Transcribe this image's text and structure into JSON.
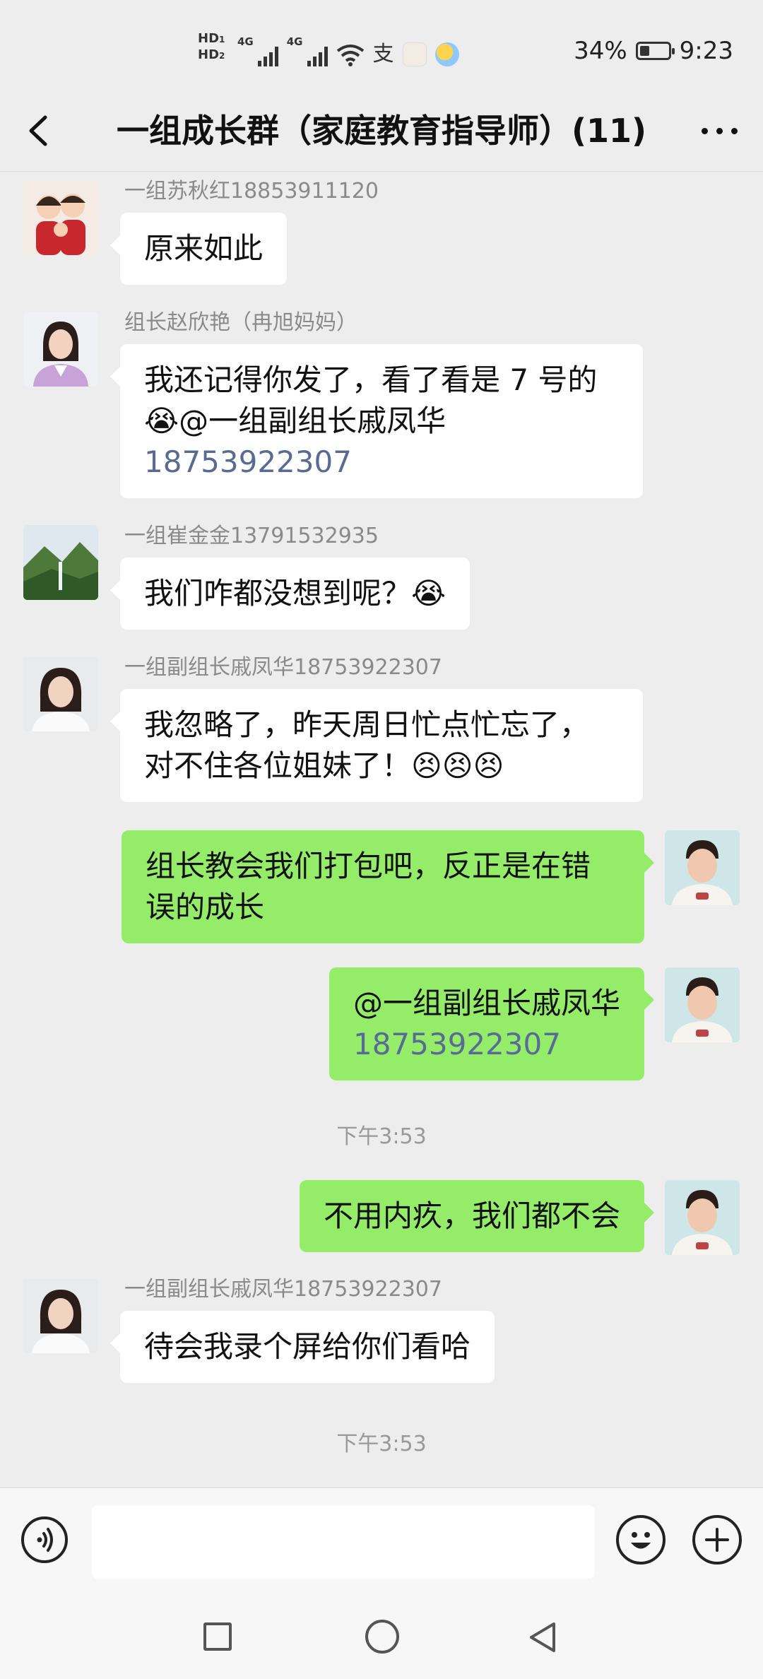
{
  "status_bar": {
    "hd1": "HD",
    "hd2": "HD",
    "network": "4G",
    "battery_text": "34%",
    "battery_level": 0.34,
    "time": "9:23"
  },
  "nav": {
    "title": "一组成长群（家庭教育指导师）(11)",
    "back_icon": "chevron-left-icon",
    "more_icon": "more-dots-icon"
  },
  "messages": [
    {
      "direction": "in",
      "sender": "一组苏秋红18853911120",
      "lines": [
        "原来如此"
      ]
    },
    {
      "direction": "in",
      "sender": "组长赵欣艳（冉旭妈妈）",
      "lines": [
        "我还记得你发了，看了看是 7 号的",
        "😭@一组副组长戚凤华",
        "18753922307"
      ]
    },
    {
      "direction": "in",
      "sender": "一组崔金金13791532935",
      "lines": [
        "我们咋都没想到呢？😭"
      ]
    },
    {
      "direction": "in",
      "sender": "一组副组长戚凤华18753922307",
      "lines": [
        "我忽略了，昨天周日忙点忙忘了，",
        "对不住各位姐妹了！😣😣😣"
      ]
    },
    {
      "direction": "out",
      "lines": [
        "组长教会我们打包吧，反正是在错",
        "误的成长"
      ]
    },
    {
      "direction": "out",
      "lines": [
        "@一组副组长戚凤华",
        "18753922307"
      ]
    },
    {
      "timestamp": "下午3:53"
    },
    {
      "direction": "out",
      "lines": [
        "不用内疚，我们都不会"
      ]
    },
    {
      "direction": "in",
      "sender": "一组副组长戚凤华18753922307",
      "lines": [
        "待会我录个屏给你们看哈"
      ]
    },
    {
      "timestamp": "下午3:53"
    }
  ],
  "input_bar": {
    "text_value": "",
    "voice_icon": "voice-icon",
    "emoji_icon": "smiley-icon",
    "plus_icon": "plus-icon"
  },
  "colors": {
    "background": "#ededed",
    "outgoing_bubble": "#95ec69",
    "incoming_bubble": "#ffffff",
    "mention": "#576b95"
  }
}
